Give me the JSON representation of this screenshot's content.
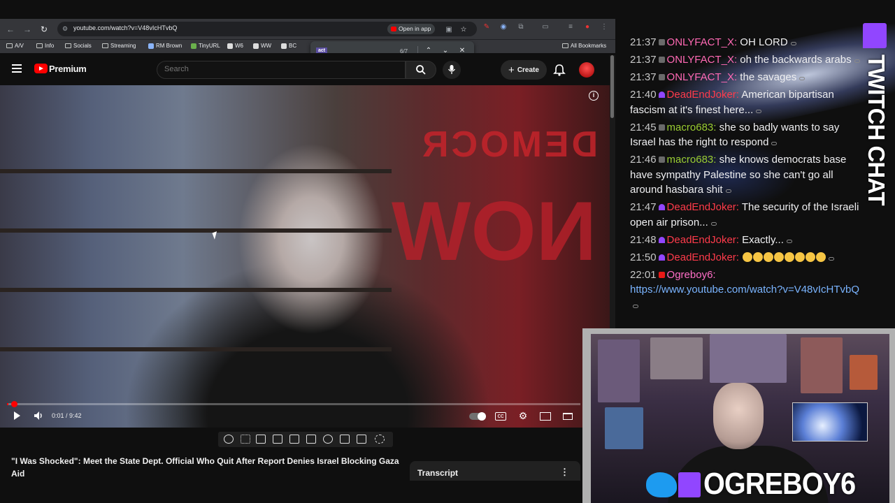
{
  "browser": {
    "url": "youtube.com/watch?v=V48vIcHTvbQ",
    "open_in_app_label": "Open in app",
    "bookmarks": [
      "A/V",
      "Info",
      "Socials",
      "Streaming",
      "RM Brown",
      "TinyURL",
      "W6",
      "WW",
      "BC"
    ],
    "all_bookmarks_label": "All Bookmarks",
    "find_bar": {
      "query": "act",
      "count": "6/7"
    }
  },
  "youtube": {
    "brand": "Premium",
    "search_placeholder": "Search",
    "create_label": "Create",
    "video": {
      "time": "0:01 / 9:42",
      "progress_fraction": 0.002,
      "title": "\"I Was Shocked\": Meet the State Dept. Official Who Quit After Report Denies Israel Blocking Gaza Aid",
      "background_text_top": "DEMOCR",
      "background_text_big": "NOW"
    },
    "transcript_label": "Transcript"
  },
  "chat": {
    "vertical_label": "TWITCH CHAT",
    "messages": [
      {
        "time": "21:37",
        "user": "ONLYFACT_X:",
        "color": "#ff69b4",
        "text": " OH LORD"
      },
      {
        "time": "21:37",
        "user": "ONLYFACT_X:",
        "color": "#ff69b4",
        "text": " oh the backwards arabs"
      },
      {
        "time": "21:37",
        "user": "ONLYFACT_X:",
        "color": "#ff69b4",
        "text": " the savages"
      },
      {
        "time": "21:40",
        "user": "DeadEndJoker:",
        "color": "#ff3b4b",
        "text": " American bipartisan fascism at it's finest here..."
      },
      {
        "time": "21:45",
        "user": "macro683:",
        "color": "#9acd32",
        "text": " she so badly wants to say Israel has the right to respond"
      },
      {
        "time": "21:46",
        "user": "macro683:",
        "color": "#9acd32",
        "text": " she knows democrats base have sympathy Palestine so she can't go all around hasbara shit"
      },
      {
        "time": "21:47",
        "user": "DeadEndJoker:",
        "color": "#ff3b4b",
        "text": " The security of the Israeli open air prison..."
      },
      {
        "time": "21:48",
        "user": "DeadEndJoker:",
        "color": "#ff3b4b",
        "text": " Exactly..."
      },
      {
        "time": "21:50",
        "user": "DeadEndJoker:",
        "color": "#ff3b4b",
        "text": " "
      },
      {
        "time": "22:01",
        "user": "Ogreboy6:",
        "color": "#ff6ec7",
        "text": " ",
        "link": "https://www.youtube.com/watch?v=V48vIcHTvbQ"
      }
    ]
  },
  "overlay": {
    "channel_name": "OGREBOY6"
  }
}
